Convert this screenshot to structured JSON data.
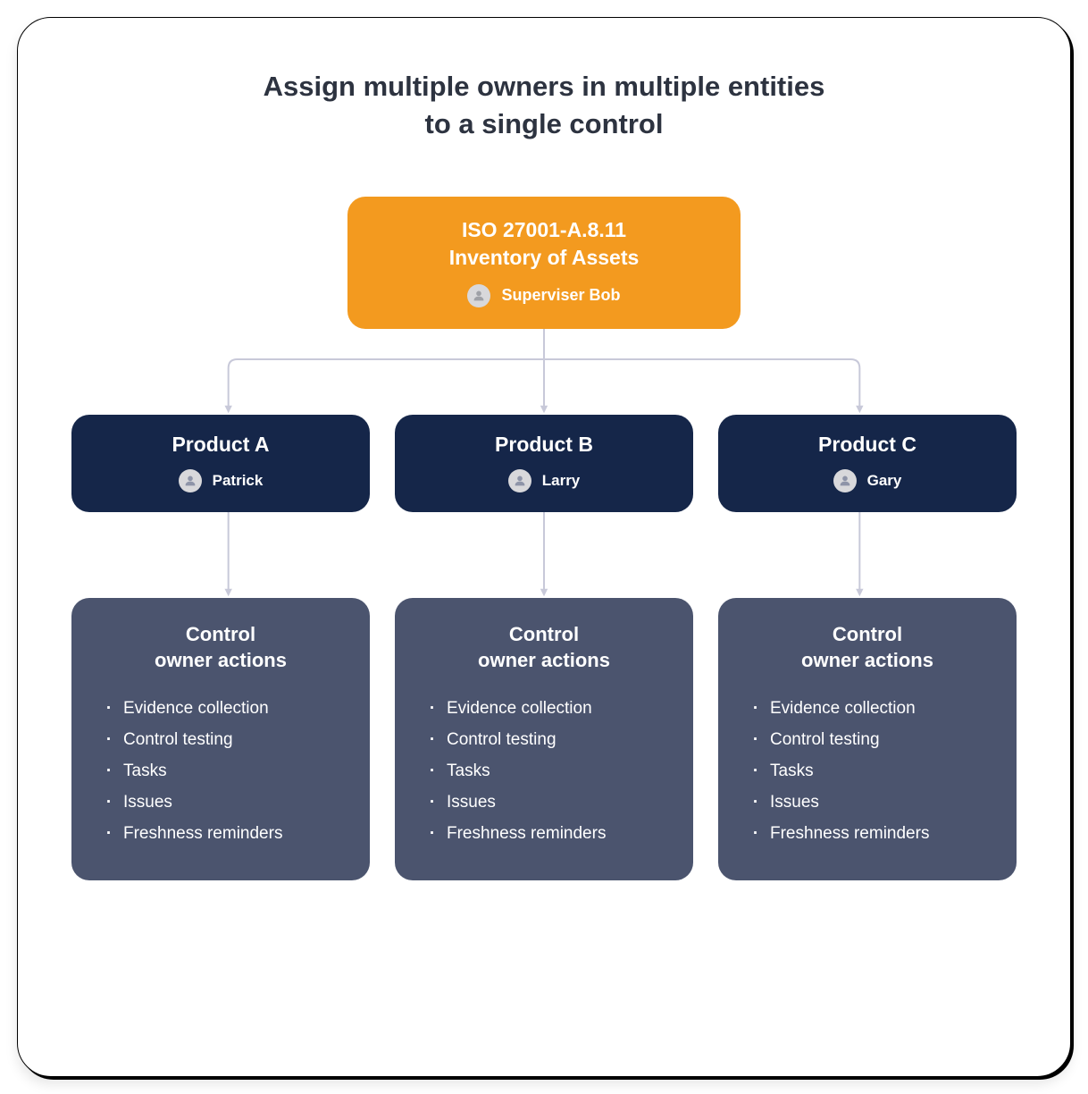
{
  "title_line1": "Assign multiple owners in multiple entities",
  "title_line2": "to a single control",
  "control": {
    "code": "ISO 27001-A.8.11",
    "name": "Inventory of Assets",
    "owner": "Superviser Bob"
  },
  "products": [
    {
      "name": "Product A",
      "owner": "Patrick"
    },
    {
      "name": "Product B",
      "owner": "Larry"
    },
    {
      "name": "Product C",
      "owner": "Gary"
    }
  ],
  "actions": {
    "title_line1": "Control",
    "title_line2": "owner actions",
    "items": [
      "Evidence collection",
      "Control testing",
      "Tasks",
      "Issues",
      "Freshness reminders"
    ]
  },
  "colors": {
    "orange": "#f39a1f",
    "navy": "#152649",
    "slate": "#4b546e",
    "title": "#2d3340",
    "connector": "#c8c9d9"
  }
}
